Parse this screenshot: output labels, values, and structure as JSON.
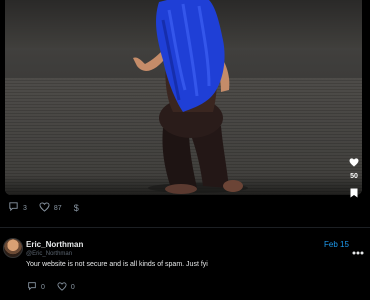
{
  "post": {
    "photo": {
      "description_icon": "photo",
      "like_count": "50"
    },
    "stats": {
      "comments": "3",
      "likes": "87",
      "tip_symbol": "$"
    }
  },
  "comment": {
    "author_name": "Eric_Northman",
    "author_handle": "@Eric_Northman",
    "date": "Feb 15",
    "text": "Your website is not secure and is all kinds of spam. Just fyi",
    "reply_count": "0",
    "like_count": "0"
  },
  "colors": {
    "background": "#000000",
    "accent": "#1d9bf0",
    "muted": "#8b98a5"
  }
}
